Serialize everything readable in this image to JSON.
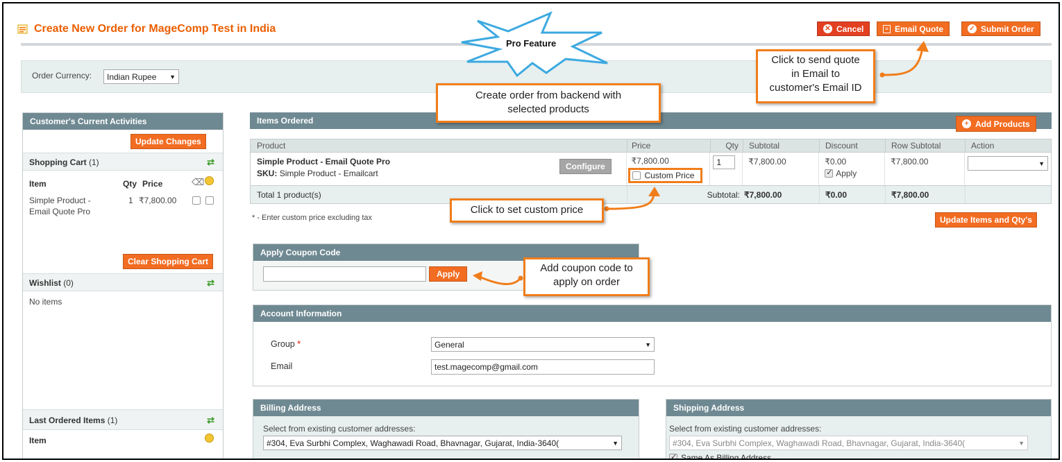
{
  "header": {
    "title": "Create New Order for MageComp Test in India",
    "buttons": {
      "cancel": "Cancel",
      "email_quote": "Email Quote",
      "submit": "Submit Order"
    }
  },
  "currency": {
    "label": "Order Currency:",
    "value": "Indian Rupee"
  },
  "sidebar": {
    "title": "Customer's Current Activities",
    "update_changes": "Update Changes",
    "shopping_cart": {
      "label": "Shopping Cart",
      "count": "(1)"
    },
    "cart_columns": {
      "item": "Item",
      "qty": "Qty",
      "price": "Price"
    },
    "cart_item": {
      "name_line1": "Simple Product -",
      "name_line2": "Email Quote Pro",
      "qty": "1",
      "price": "₹7,800.00"
    },
    "clear_cart": "Clear Shopping Cart",
    "wishlist": {
      "label": "Wishlist",
      "count": "(0)",
      "empty": "No items"
    },
    "last_ordered": {
      "label": "Last Ordered Items",
      "count": "(1)",
      "column_item": "Item"
    }
  },
  "items": {
    "title": "Items Ordered",
    "add_products": "Add Products",
    "columns": {
      "product": "Product",
      "price": "Price",
      "qty": "Qty",
      "subtotal": "Subtotal",
      "discount": "Discount",
      "row_subtotal": "Row Subtotal",
      "action": "Action"
    },
    "row": {
      "name": "Simple Product - Email Quote Pro",
      "sku_label": "SKU:",
      "sku": "Simple Product - Emailcart",
      "configure": "Configure",
      "price": "₹7,800.00",
      "custom_price": "Custom Price",
      "qty": "1",
      "subtotal": "₹7,800.00",
      "discount": "₹0.00",
      "apply": "Apply",
      "row_subtotal": "₹7,800.00"
    },
    "total": {
      "label": "Total 1 product(s)",
      "subtotal_label": "Subtotal:",
      "subtotal": "₹7,800.00",
      "discount": "₹0.00",
      "row_subtotal": "₹7,800.00"
    },
    "note": "* - Enter custom price excluding tax",
    "update_button": "Update Items and Qty's"
  },
  "coupon": {
    "title": "Apply Coupon Code",
    "value": "",
    "apply": "Apply"
  },
  "account": {
    "title": "Account Information",
    "group_label": "Group",
    "required_mark": "*",
    "group_value": "General",
    "email_label": "Email",
    "email_value": "test.magecomp@gmail.com"
  },
  "billing": {
    "title": "Billing Address",
    "select_label": "Select from existing customer addresses:",
    "select_value": "#304, Eva Surbhi Complex, Waghawadi Road, Bhavnagar, Gujarat, India-3640("
  },
  "shipping": {
    "title": "Shipping Address",
    "select_label": "Select from existing customer addresses:",
    "select_value": "#304, Eva Surbhi Complex, Waghawadi Road, Bhavnagar, Gujarat, India-3640(",
    "same_as_billing": "Same As Billing Address"
  },
  "annotations": {
    "pro_feature": "Pro Feature",
    "email_quote_line1": "Click to send quote",
    "email_quote_line2": "in Email to",
    "email_quote_line3": "customer's Email ID",
    "create_order_line1": "Create order from backend with",
    "create_order_line2": "selected products",
    "custom_price": "Click to set custom price",
    "coupon_line1": "Add coupon code to",
    "coupon_line2": "apply on order"
  },
  "colors": {
    "accent": "#f26c22",
    "panel_header": "#6f8992",
    "annotation_border": "#f07d1a",
    "title": "#eb5e00"
  }
}
